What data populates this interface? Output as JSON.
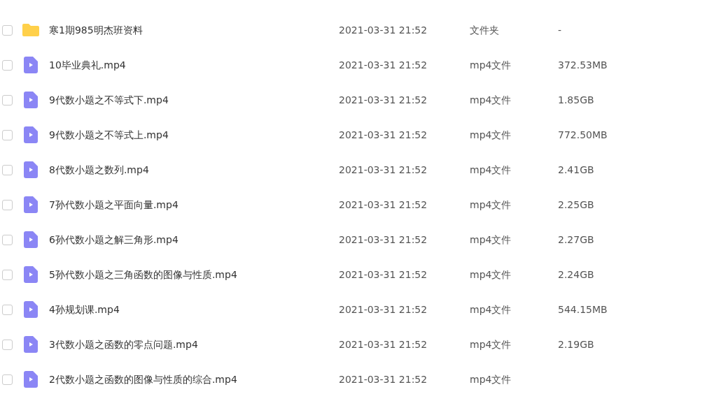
{
  "rows": [
    {
      "kind": "folder",
      "selected": false,
      "name": "寒1期985明杰班资料",
      "modified": "2021-03-31 21:52",
      "type": "文件夹",
      "size": "-"
    },
    {
      "kind": "video",
      "selected": false,
      "name": "10毕业典礼.mp4",
      "modified": "2021-03-31 21:52",
      "type": "mp4文件",
      "size": "372.53MB"
    },
    {
      "kind": "video",
      "selected": false,
      "name": "9代数小题之不等式下.mp4",
      "modified": "2021-03-31 21:52",
      "type": "mp4文件",
      "size": "1.85GB"
    },
    {
      "kind": "video",
      "selected": false,
      "name": "9代数小题之不等式上.mp4",
      "modified": "2021-03-31 21:52",
      "type": "mp4文件",
      "size": "772.50MB"
    },
    {
      "kind": "video",
      "selected": false,
      "name": "8代数小题之数列.mp4",
      "modified": "2021-03-31 21:52",
      "type": "mp4文件",
      "size": "2.41GB"
    },
    {
      "kind": "video",
      "selected": false,
      "name": "7孙代数小题之平面向量.mp4",
      "modified": "2021-03-31 21:52",
      "type": "mp4文件",
      "size": "2.25GB"
    },
    {
      "kind": "video",
      "selected": false,
      "name": "6孙代数小题之解三角形.mp4",
      "modified": "2021-03-31 21:52",
      "type": "mp4文件",
      "size": "2.27GB"
    },
    {
      "kind": "video",
      "selected": false,
      "name": "5孙代数小题之三角函数的图像与性质.mp4",
      "modified": "2021-03-31 21:52",
      "type": "mp4文件",
      "size": "2.24GB"
    },
    {
      "kind": "video",
      "selected": false,
      "name": "4孙规划课.mp4",
      "modified": "2021-03-31 21:52",
      "type": "mp4文件",
      "size": "544.15MB"
    },
    {
      "kind": "video",
      "selected": false,
      "name": "3代数小题之函数的零点问题.mp4",
      "modified": "2021-03-31 21:52",
      "type": "mp4文件",
      "size": "2.19GB"
    },
    {
      "kind": "video",
      "selected": false,
      "name": "2代数小题之函数的图像与性质的综合.mp4",
      "modified": "2021-03-31 21:52",
      "type": "mp4文件"
    }
  ]
}
